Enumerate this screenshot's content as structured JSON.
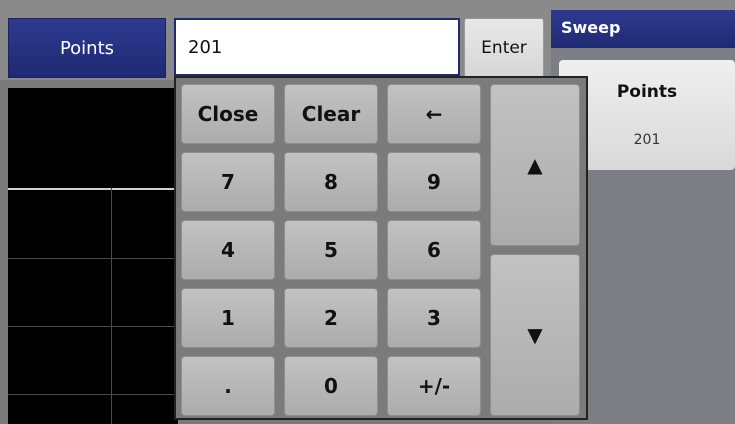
{
  "header": {
    "parameter_label": "Points",
    "value": "201",
    "enter_label": "Enter"
  },
  "sweep_panel": {
    "title": "Sweep",
    "points_card": {
      "title": "Points",
      "value": "201"
    }
  },
  "keypad": {
    "close": "Close",
    "clear": "Clear",
    "backspace": "←",
    "k7": "7",
    "k8": "8",
    "k9": "9",
    "k4": "4",
    "k5": "5",
    "k6": "6",
    "k1": "1",
    "k2": "2",
    "k3": "3",
    "dot": ".",
    "k0": "0",
    "sign": "+/-",
    "up": "▲",
    "down": "▼"
  },
  "colors": {
    "title_bar": "#1f2a73",
    "key_face": "#b6b6b6",
    "plot_background": "#000000"
  }
}
